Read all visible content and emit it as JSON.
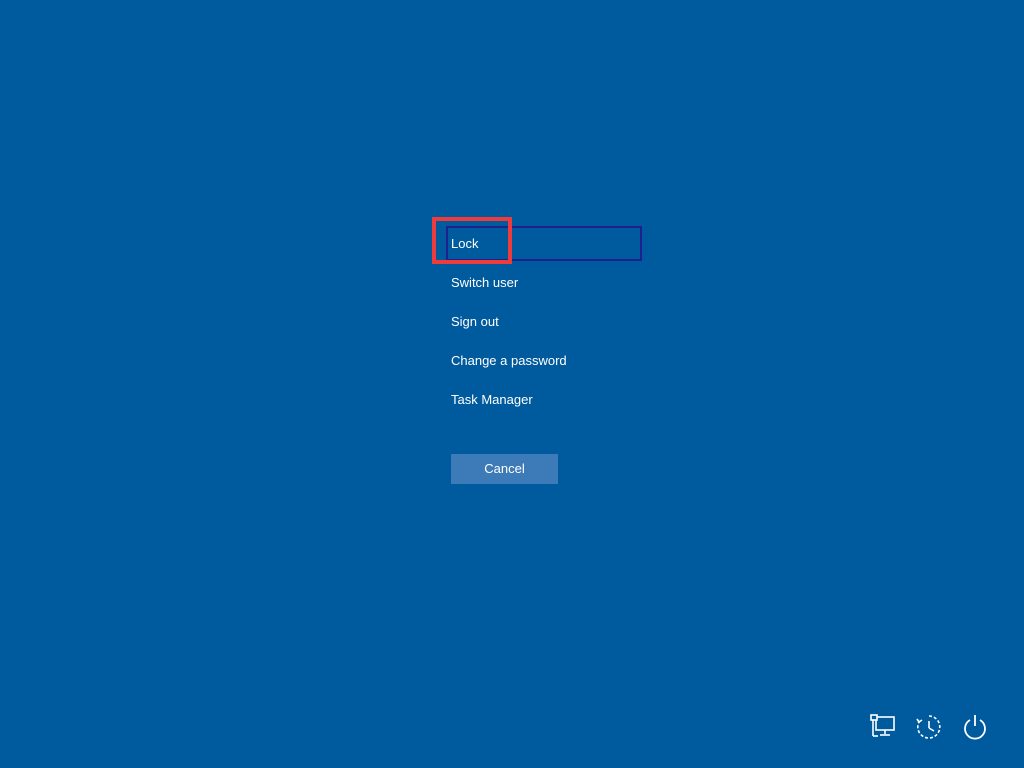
{
  "menu": {
    "items": [
      {
        "label": "Lock"
      },
      {
        "label": "Switch user"
      },
      {
        "label": "Sign out"
      },
      {
        "label": "Change a password"
      },
      {
        "label": "Task Manager"
      }
    ]
  },
  "cancel_label": "Cancel",
  "tray": {
    "icons": [
      "network-icon",
      "ease-of-access-icon",
      "power-icon"
    ]
  },
  "colors": {
    "background": "#005a9e",
    "highlight": "#ee3b3b",
    "button": "#3d7ab8"
  }
}
